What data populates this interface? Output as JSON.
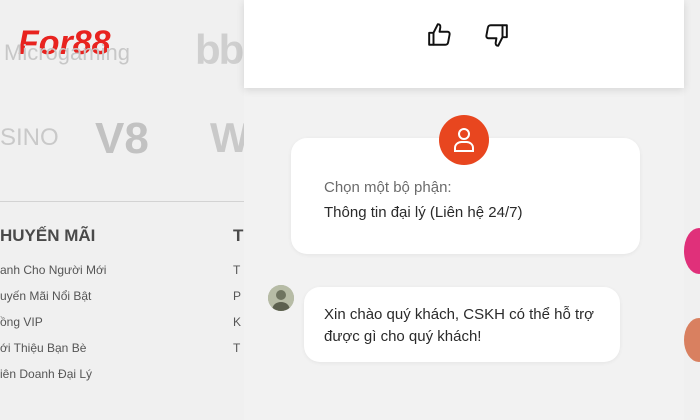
{
  "background": {
    "brand": "For88",
    "partners": [
      "Microgaming",
      "bb",
      "SINO",
      "V8",
      "W"
    ],
    "footer": {
      "col1_title": "HUYẾN MÃI",
      "col1_links": [
        "anh Cho Người Mới",
        "uyến Mãi Nổi Bật",
        "ồng VIP",
        "ới Thiệu Bạn Bè",
        "iên Doanh Đại Lý"
      ],
      "col2_title": "T",
      "col2_links": [
        "T",
        "P",
        "K",
        "T"
      ]
    }
  },
  "chat": {
    "rating": {
      "thumb_up_icon": "thumbs-up-icon",
      "thumb_down_icon": "thumbs-down-icon"
    },
    "department_card": {
      "label": "Chọn một bộ phận:",
      "value": "Thông tin đại lý (Liên hệ 24/7)"
    },
    "message": {
      "text": "Xin chào quý khách, CSKH có thể hỗ trợ được gì cho quý khách!"
    }
  },
  "colors": {
    "brand_red": "#e8231f",
    "agent_avatar": "#e8461f",
    "chat_bg": "#f2f2f2"
  }
}
